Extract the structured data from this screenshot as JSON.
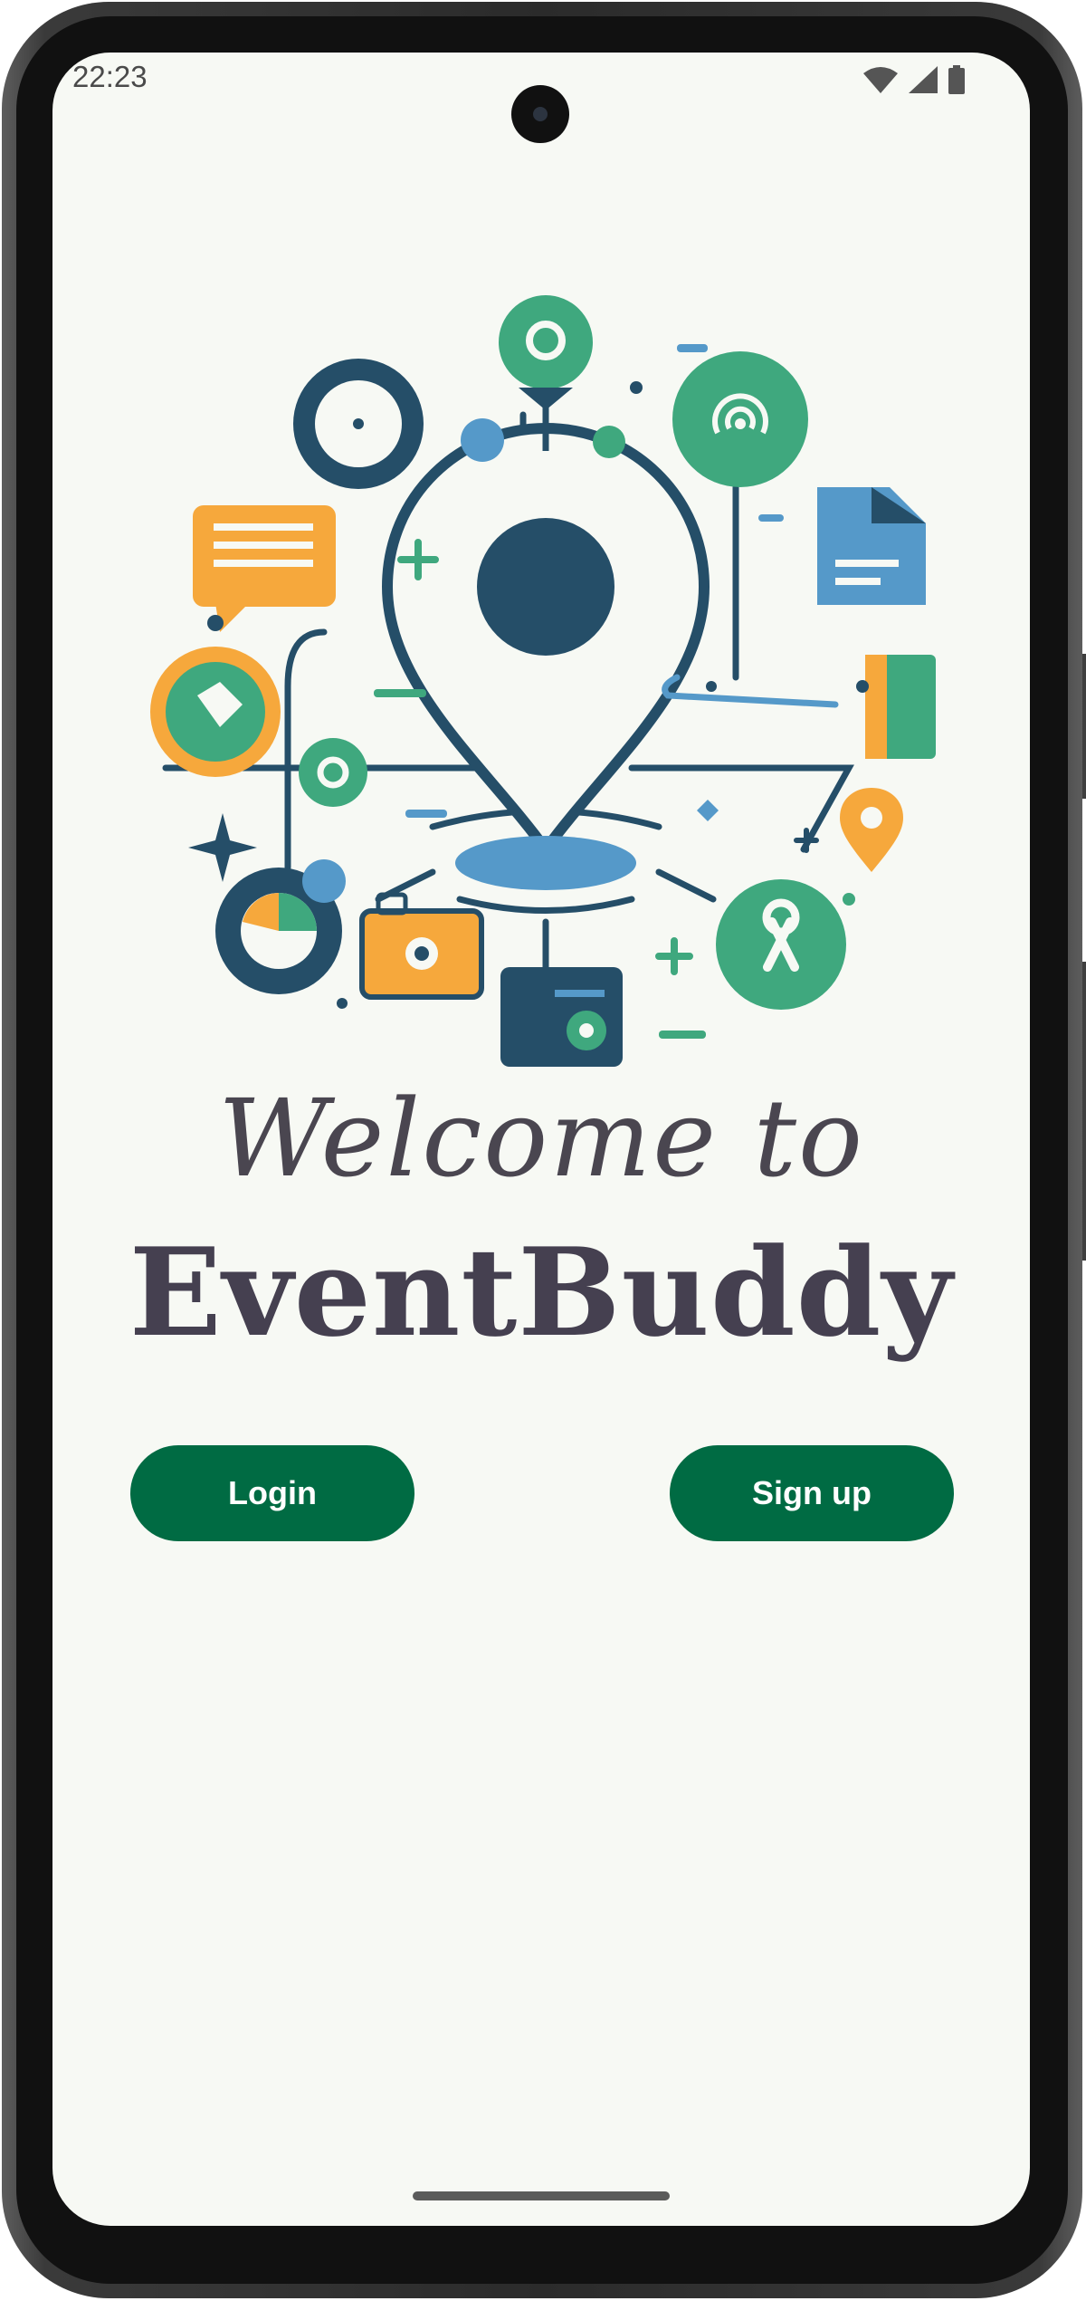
{
  "status_bar": {
    "time": "22:23",
    "icons": [
      "wifi-icon",
      "cellular-signal-icon",
      "battery-icon"
    ]
  },
  "welcome": {
    "line1": "Welcome to",
    "app_name": "EventBuddy"
  },
  "actions": {
    "login_label": "Login",
    "signup_label": "Sign up"
  },
  "colors": {
    "background": "#f7f9f4",
    "primary_button": "#006b43",
    "navy": "#254e68",
    "green": "#3fa87e",
    "orange": "#f6a83c",
    "blue": "#5599c9",
    "text": "#454050"
  }
}
